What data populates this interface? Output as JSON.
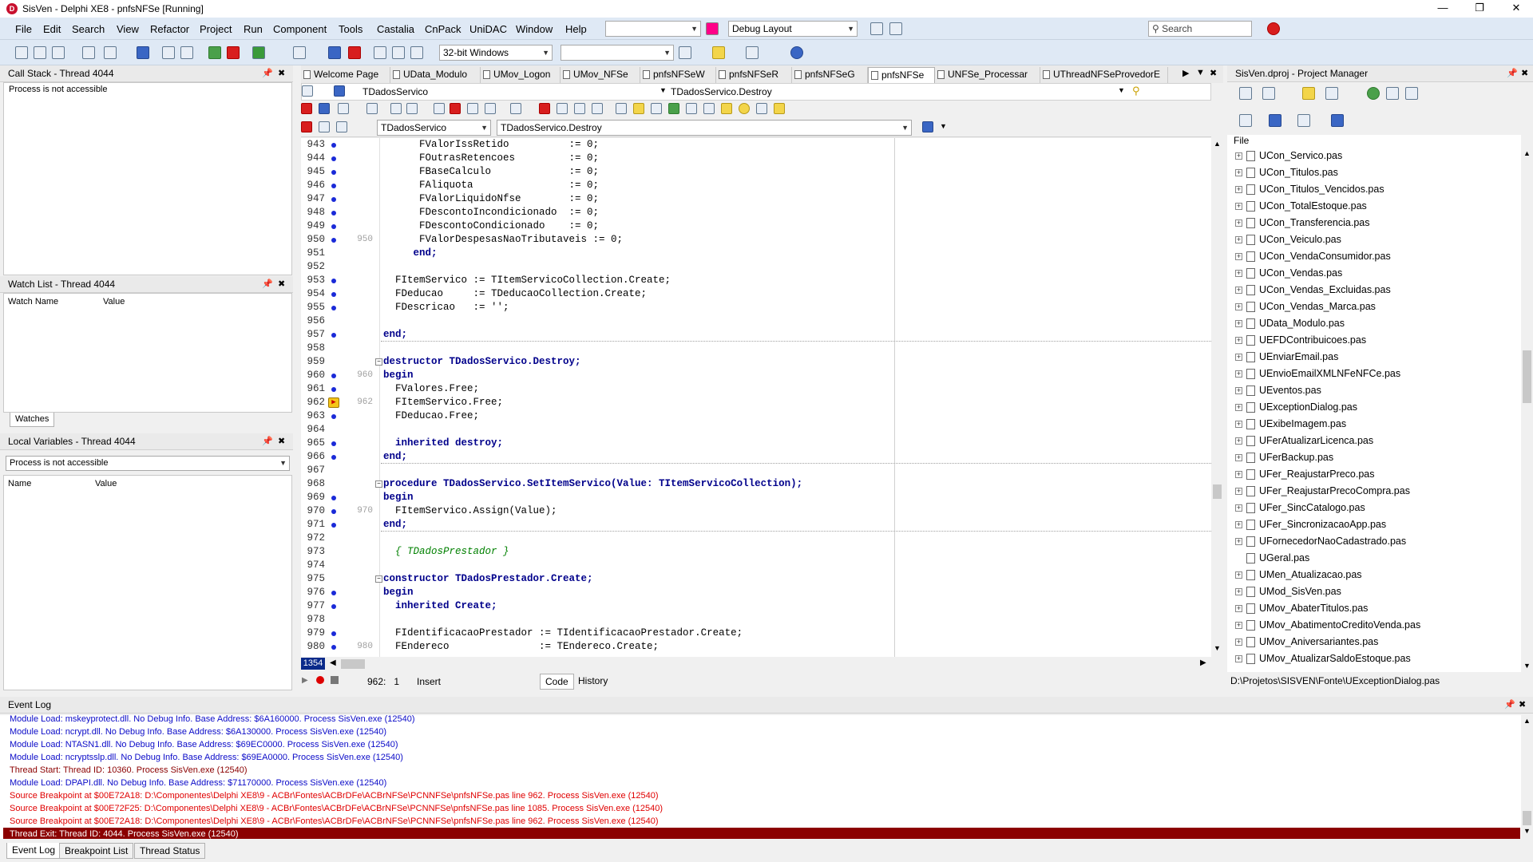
{
  "window": {
    "title": "SisVen - Delphi XE8 - pnfsNFSe [Running]",
    "app_icon_color": "#c8102e"
  },
  "menu": [
    "File",
    "Edit",
    "Search",
    "View",
    "Refactor",
    "Project",
    "Run",
    "Component",
    "Tools",
    "Castalia",
    "CnPack",
    "UniDAC",
    "Window",
    "Help"
  ],
  "toolbar": {
    "layout_combo": "Debug Layout",
    "platform_combo": "32-bit Windows",
    "search_placeholder": "Search"
  },
  "call_stack": {
    "title": "Call Stack - Thread 4044",
    "message": "Process is not accessible"
  },
  "watch_list": {
    "title": "Watch List - Thread 4044",
    "col_name": "Watch Name",
    "col_value": "Value",
    "tab": "Watches"
  },
  "local_vars": {
    "title": "Local Variables - Thread 4044",
    "combo": "Process is not accessible",
    "col_name": "Name",
    "col_value": "Value"
  },
  "editor_tabs": [
    "Welcome Page",
    "UData_Modulo",
    "UMov_Logon",
    "UMov_NFSe",
    "pnfsNFSeW",
    "pnfsNFSeR",
    "pnfsNFSeG",
    "pnfsNFSe",
    "UNFSe_Processar",
    "UThreadNFSeProvedorE"
  ],
  "active_tab_index": 7,
  "editor": {
    "scope_left": "TDadosServico",
    "scope_right": "TDadosServico.Destroy",
    "class_combo": "TDadosServico",
    "method_combo": "TDadosServico.Destroy",
    "corner_counter": "1354",
    "status_pos": "962:   1",
    "status_mode": "Insert",
    "tab_code": "Code",
    "tab_history": "History",
    "lines": [
      {
        "n": "943",
        "dot": true,
        "g": "",
        "t": "      FValorIssRetido          := 0;"
      },
      {
        "n": "944",
        "dot": true,
        "g": "",
        "t": "      FOutrasRetencoes         := 0;"
      },
      {
        "n": "945",
        "dot": true,
        "g": "",
        "t": "      FBaseCalculo             := 0;"
      },
      {
        "n": "946",
        "dot": true,
        "g": "",
        "t": "      FAliquota                := 0;"
      },
      {
        "n": "947",
        "dot": true,
        "g": "",
        "t": "      FValorLiquidoNfse        := 0;"
      },
      {
        "n": "948",
        "dot": true,
        "g": "",
        "t": "      FDescontoIncondicionado  := 0;"
      },
      {
        "n": "949",
        "dot": true,
        "g": "",
        "t": "      FDescontoCondicionado    := 0;"
      },
      {
        "n": "950",
        "dot": true,
        "g": "950",
        "t": "      FValorDespesasNaoTributaveis := 0;"
      },
      {
        "n": "951",
        "dot": false,
        "g": "",
        "t": "     end;"
      },
      {
        "n": "952",
        "dot": false,
        "g": "",
        "t": ""
      },
      {
        "n": "953",
        "dot": true,
        "g": "",
        "t": "  FItemServico := TItemServicoCollection.Create;"
      },
      {
        "n": "954",
        "dot": true,
        "g": "",
        "t": "  FDeducao     := TDeducaoCollection.Create;"
      },
      {
        "n": "955",
        "dot": true,
        "g": "",
        "t": "  FDescricao   := '';"
      },
      {
        "n": "956",
        "dot": false,
        "g": "",
        "t": ""
      },
      {
        "n": "957",
        "dot": true,
        "g": "",
        "t": "end;"
      },
      {
        "n": "958",
        "dot": false,
        "g": "",
        "t": ""
      },
      {
        "n": "959",
        "dot": false,
        "g": "",
        "t": "destructor TDadosServico.Destroy;"
      },
      {
        "n": "960",
        "dot": true,
        "g": "960",
        "t": "begin"
      },
      {
        "n": "961",
        "dot": true,
        "g": "",
        "t": "  FValores.Free;"
      },
      {
        "n": "962",
        "dot": false,
        "g": "962",
        "t": "  FItemServico.Free;"
      },
      {
        "n": "963",
        "dot": true,
        "g": "",
        "t": "  FDeducao.Free;"
      },
      {
        "n": "964",
        "dot": false,
        "g": "",
        "t": ""
      },
      {
        "n": "965",
        "dot": true,
        "g": "",
        "t": "  inherited destroy;"
      },
      {
        "n": "966",
        "dot": true,
        "g": "",
        "t": "end;"
      },
      {
        "n": "967",
        "dot": false,
        "g": "",
        "t": ""
      },
      {
        "n": "968",
        "dot": false,
        "g": "",
        "t": "procedure TDadosServico.SetItemServico(Value: TItemServicoCollection);"
      },
      {
        "n": "969",
        "dot": true,
        "g": "",
        "t": "begin"
      },
      {
        "n": "970",
        "dot": true,
        "g": "970",
        "t": "  FItemServico.Assign(Value);"
      },
      {
        "n": "971",
        "dot": true,
        "g": "",
        "t": "end;"
      },
      {
        "n": "972",
        "dot": false,
        "g": "",
        "t": ""
      },
      {
        "n": "973",
        "dot": false,
        "g": "",
        "t": "  { TDadosPrestador }"
      },
      {
        "n": "974",
        "dot": false,
        "g": "",
        "t": ""
      },
      {
        "n": "975",
        "dot": false,
        "g": "",
        "t": "constructor TDadosPrestador.Create;"
      },
      {
        "n": "976",
        "dot": true,
        "g": "",
        "t": "begin"
      },
      {
        "n": "977",
        "dot": true,
        "g": "",
        "t": "  inherited Create;"
      },
      {
        "n": "978",
        "dot": false,
        "g": "",
        "t": ""
      },
      {
        "n": "979",
        "dot": true,
        "g": "",
        "t": "  FIdentificacaoPrestador := TIdentificacaoPrestador.Create;"
      },
      {
        "n": "980",
        "dot": true,
        "g": "980",
        "t": "  FEndereco               := TEndereco.Create;"
      }
    ]
  },
  "project_manager": {
    "title": "SisVen.dproj - Project Manager",
    "root_label": "File",
    "files": [
      "UCon_Servico.pas",
      "UCon_Titulos.pas",
      "UCon_Titulos_Vencidos.pas",
      "UCon_TotalEstoque.pas",
      "UCon_Transferencia.pas",
      "UCon_Veiculo.pas",
      "UCon_VendaConsumidor.pas",
      "UCon_Vendas.pas",
      "UCon_Vendas_Excluidas.pas",
      "UCon_Vendas_Marca.pas",
      "UData_Modulo.pas",
      "UEFDContribuicoes.pas",
      "UEnviarEmail.pas",
      "UEnvioEmailXMLNFeNFCe.pas",
      "UEventos.pas",
      "UExceptionDialog.pas",
      "UExibeImagem.pas",
      "UFerAtualizarLicenca.pas",
      "UFerBackup.pas",
      "UFer_ReajustarPreco.pas",
      "UFer_ReajustarPrecoCompra.pas",
      "UFer_SincCatalogo.pas",
      "UFer_SincronizacaoApp.pas",
      "UFornecedorNaoCadastrado.pas",
      "UGeral.pas",
      "UMen_Atualizacao.pas",
      "UMod_SisVen.pas",
      "UMov_AbaterTitulos.pas",
      "UMov_AbatimentoCreditoVenda.pas",
      "UMov_Aniversariantes.pas",
      "UMov_AtualizarSaldoEstoque.pas"
    ],
    "path": "D:\\Projetos\\SISVEN\\Fonte\\UExceptionDialog.pas"
  },
  "event_log": {
    "title": "Event Log",
    "rows": [
      {
        "c": "#0b0bc8",
        "t": "Module Load: mskeyprotect.dll. No Debug Info. Base Address: $6A160000. Process SisVen.exe (12540)"
      },
      {
        "c": "#0b0bc8",
        "t": "Module Load: ncrypt.dll. No Debug Info. Base Address: $6A130000. Process SisVen.exe (12540)"
      },
      {
        "c": "#0b0bc8",
        "t": "Module Load: NTASN1.dll. No Debug Info. Base Address: $69EC0000. Process SisVen.exe (12540)"
      },
      {
        "c": "#0b0bc8",
        "t": "Module Load: ncryptsslp.dll. No Debug Info. Base Address: $69EA0000. Process SisVen.exe (12540)"
      },
      {
        "c": "#8b0000",
        "t": "Thread Start: Thread ID: 10360. Process SisVen.exe (12540)"
      },
      {
        "c": "#0b0bc8",
        "t": "Module Load: DPAPI.dll. No Debug Info. Base Address: $71170000. Process SisVen.exe (12540)"
      },
      {
        "c": "#e00000",
        "t": "Source Breakpoint at $00E72A18: D:\\Componentes\\Delphi XE8\\9 - ACBr\\Fontes\\ACBrDFe\\ACBrNFSe\\PCNNFSe\\pnfsNFSe.pas line 962. Process SisVen.exe (12540)"
      },
      {
        "c": "#e00000",
        "t": "Source Breakpoint at $00E72F25: D:\\Componentes\\Delphi XE8\\9 - ACBr\\Fontes\\ACBrDFe\\ACBrNFSe\\PCNNFSe\\pnfsNFSe.pas line 1085. Process SisVen.exe (12540)"
      },
      {
        "c": "#e00000",
        "t": "Source Breakpoint at $00E72A18: D:\\Componentes\\Delphi XE8\\9 - ACBr\\Fontes\\ACBrDFe\\ACBrNFSe\\PCNNFSe\\pnfsNFSe.pas line 962. Process SisVen.exe (12540)"
      },
      {
        "c": "#ffffff",
        "t": "Thread Exit: Thread ID: 4044. Process SisVen.exe (12540)"
      }
    ],
    "tabs": [
      "Event Log",
      "Breakpoint List",
      "Thread Status"
    ]
  }
}
